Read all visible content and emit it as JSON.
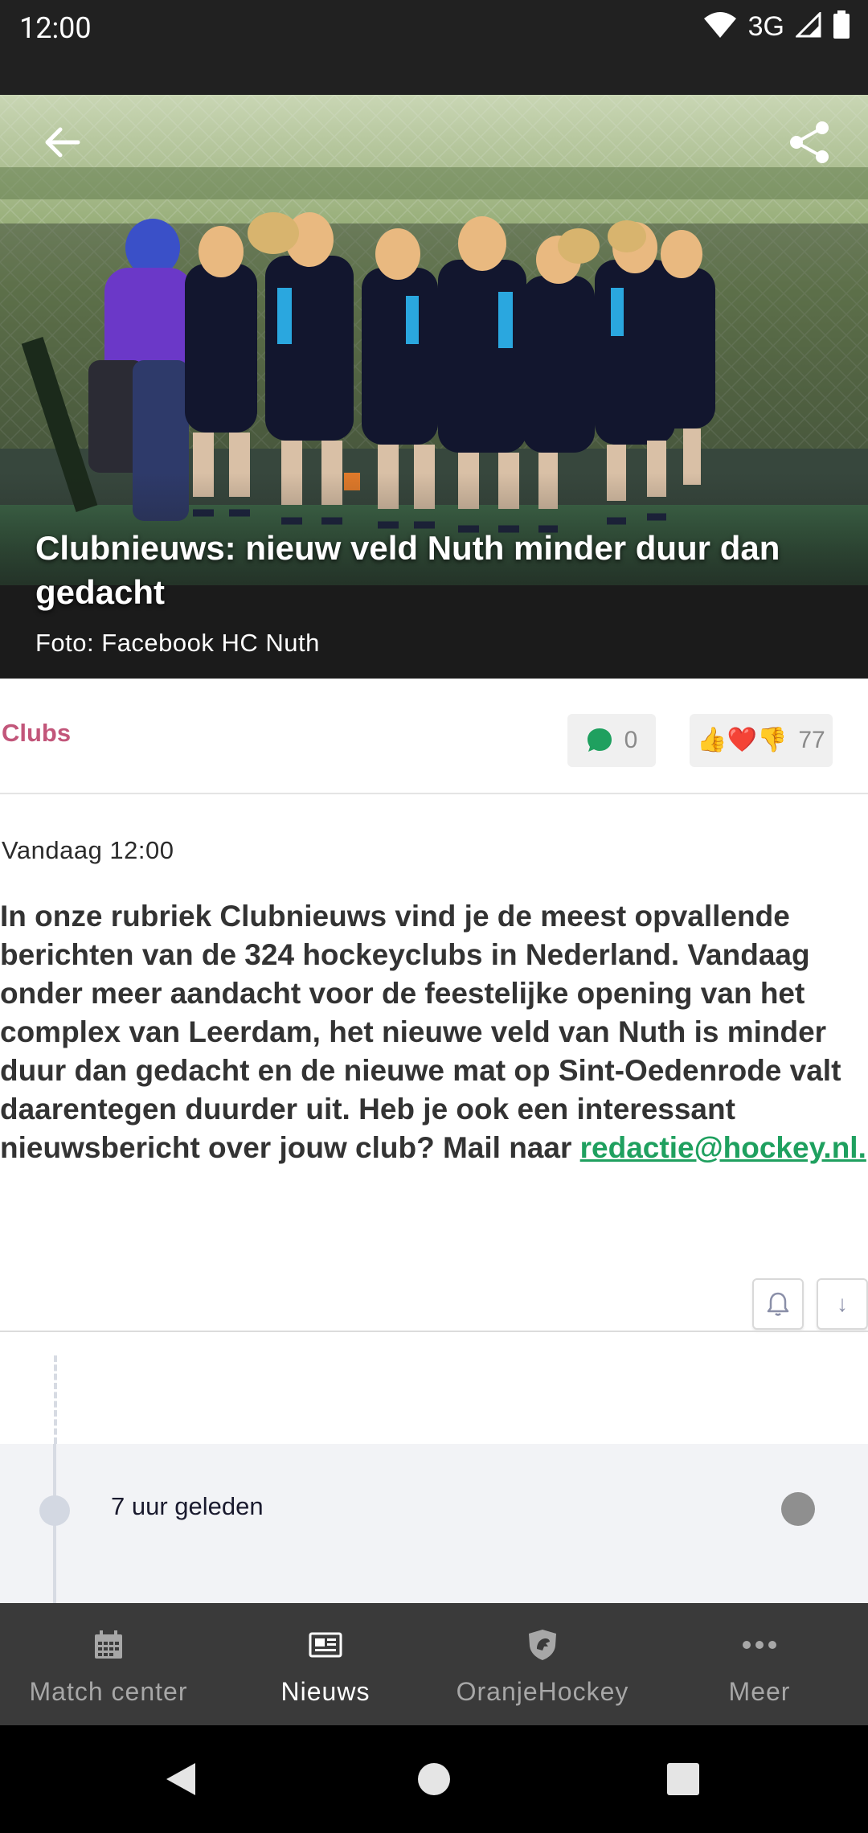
{
  "status_bar": {
    "time": "12:00",
    "network": "3G"
  },
  "article": {
    "title": "Clubnieuws: nieuw veld Nuth minder duur dan gedacht",
    "photo_caption": "Foto: Facebook HC Nuth",
    "category": "Clubs",
    "comment_count": "0",
    "reaction_emojis": "👍❤️👎",
    "reaction_count": "77",
    "date": "Vandaag 12:00",
    "intro": "In onze rubriek Clubnieuws vind je de meest opvallende berichten van de 324 hockeyclubs in Nederland. Vandaag onder meer aandacht voor de feestelijke opening van het complex van Leerdam, het nieuwe veld van Nuth is minder duur dan gedacht en de nieuwe mat op Sint-Oedenrode valt daarentegen duurder uit. Heb je ook een interessant nieuwsbericht over jouw club? Mail naar",
    "email_link": "redactie@hockey.nl.",
    "down_arrow": "↓"
  },
  "timeline": {
    "entry_time": "7 uur geleden"
  },
  "bottom_nav": {
    "items": [
      {
        "label": "Match center",
        "icon": "calendar-icon"
      },
      {
        "label": "Nieuws",
        "icon": "newspaper-icon"
      },
      {
        "label": "OranjeHockey",
        "icon": "shield-logo-icon"
      },
      {
        "label": "Meer",
        "icon": "more-dots-icon"
      }
    ],
    "active_index": 1
  },
  "colors": {
    "category": "#c2567a",
    "link": "#1fa05f",
    "comment_bubble": "#1fa05f",
    "nav_background": "#3a3a3a",
    "status_bar": "#212121"
  }
}
